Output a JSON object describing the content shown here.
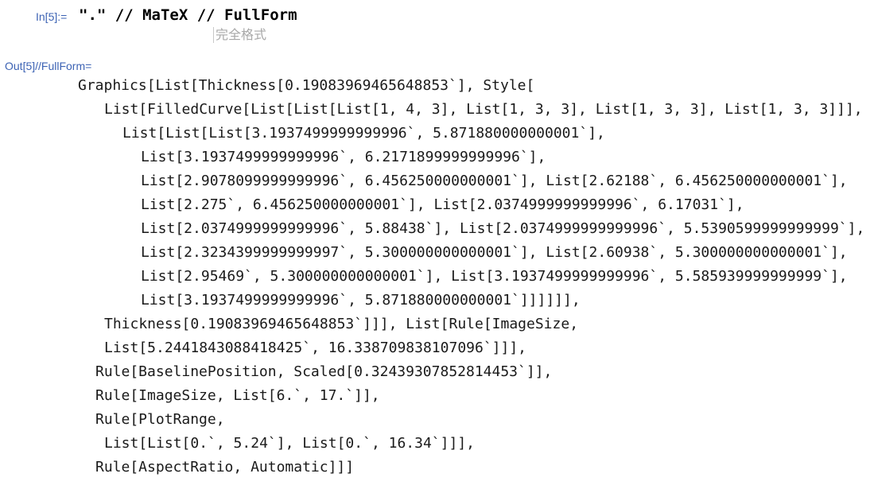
{
  "input_cell": {
    "label": "In[5]:=",
    "code": "\".\" // MaTeX // FullForm",
    "autocomplete_hint": "完全格式"
  },
  "output_cell": {
    "label": "Out[5]//FullForm=",
    "lines": [
      "Graphics[List[Thickness[0.19083969465648853`], Style[",
      "List[FilledCurve[List[List[List[1, 4, 3], List[1, 3, 3], List[1, 3, 3], List[1, 3, 3]]],",
      "List[List[List[3.1937499999999996`, 5.871880000000001`],",
      "List[3.1937499999999996`, 6.2171899999999996`],",
      "List[2.9078099999999996`, 6.456250000000001`], List[2.62188`, 6.456250000000001`],",
      "List[2.275`, 6.456250000000001`], List[2.0374999999999996`, 6.17031`],",
      "List[2.0374999999999996`, 5.88438`], List[2.0374999999999996`, 5.5390599999999999`],",
      "List[2.3234399999999997`, 5.300000000000001`], List[2.60938`, 5.300000000000001`],",
      "List[2.95469`, 5.300000000000001`], List[3.1937499999999996`, 5.585939999999999`],",
      "List[3.1937499999999996`, 5.871880000000001`]]]]]],",
      "Thickness[0.19083969465648853`]]], List[Rule[ImageSize,",
      "List[5.2441843088418425`, 16.338709838107096`]]],",
      "Rule[BaselinePosition, Scaled[0.32439307852814453`]],",
      "Rule[ImageSize, List[6.`, 17.`]],",
      "Rule[PlotRange,",
      "List[List[0.`, 5.24`], List[0.`, 16.34`]]],",
      "Rule[AspectRatio, Automatic]]]"
    ]
  }
}
